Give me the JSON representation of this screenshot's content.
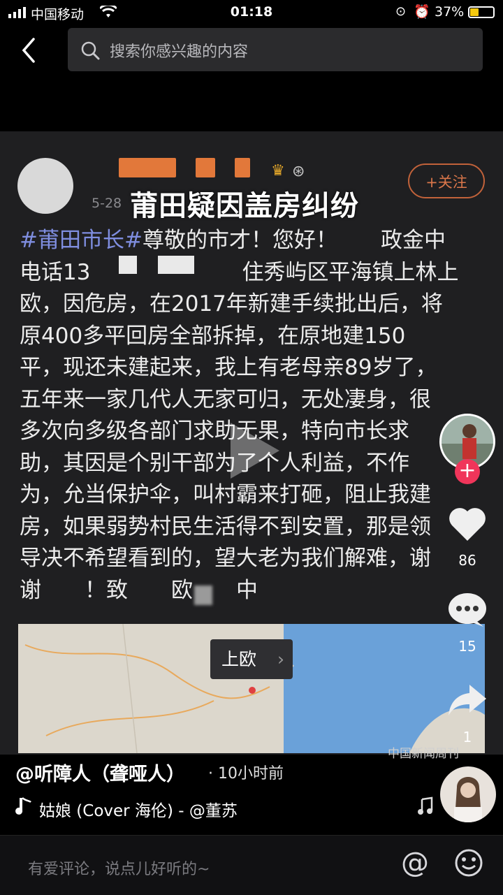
{
  "status_bar": {
    "carrier": "中国移动",
    "time": "01:18",
    "battery": "37%"
  },
  "search": {
    "placeholder": "搜索你感兴趣的内容"
  },
  "post": {
    "overlay_title": "莆田疑因盖房纠纷",
    "date": "5-28",
    "follow_label": "+关注",
    "body_lines": [
      {
        "tag": "#莆田市长#",
        "text": "尊敬的市才！您好！　　政金中"
      },
      {
        "tag": "",
        "text": "电话13　　　　　　　住秀屿区平海镇上林上"
      },
      {
        "tag": "",
        "text": "欧，因危房，在2017年新建手续批出后，将"
      },
      {
        "tag": "",
        "text": "原400多平回房全部拆掉，在原地建150"
      },
      {
        "tag": "",
        "text": "平，现还未建起来，我上有老母亲89岁了，"
      },
      {
        "tag": "",
        "text": "五年来一家几代人无家可归，无处凄身，很"
      },
      {
        "tag": "",
        "text": "多次向多级各部门求助无果，特向市长求"
      },
      {
        "tag": "",
        "text": "助，其因是个别干部为了个人利益，不作"
      },
      {
        "tag": "",
        "text": "为，允当保护伞，叫村霸来打砸，阻止我建"
      },
      {
        "tag": "",
        "text": "房，如果弱势村民生活得不到安置，那是领"
      },
      {
        "tag": "",
        "text": "导决不希望看到的，望大老为我们解难，谢"
      },
      {
        "tag": "",
        "text": "谢　　！致　　欧　　中"
      }
    ],
    "map_label": "上欧",
    "watermark": "中国新闻周刊"
  },
  "rail": {
    "likes": "86",
    "comments": "15",
    "shares": "1"
  },
  "info": {
    "author": "@听障人（聋哑人）",
    "time_ago": "· 10小时前",
    "music": "姑娘 (Cover 海伦) - @董苏"
  },
  "comment": {
    "placeholder": "有爱评论，说点儿好听的~"
  }
}
